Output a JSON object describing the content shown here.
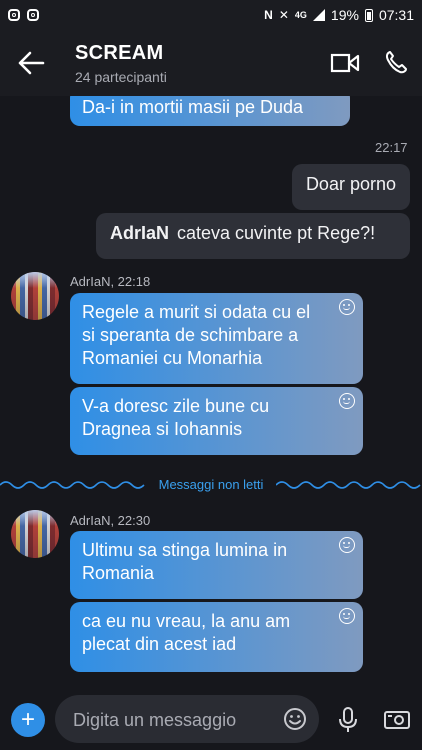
{
  "status_bar": {
    "left_icons": [
      "instagram-icon",
      "instagram-icon"
    ],
    "network": "4G",
    "battery": "19%",
    "time": "07:31"
  },
  "header": {
    "title": "SCREAM",
    "subtitle": "24 partecipanti"
  },
  "messages": {
    "partial_top": "Da-i in mortii masii pe Duda",
    "time_2217": "22:17",
    "out1": "Doar porno",
    "out2_sender": "AdrIaN",
    "out2_text": "cateva cuvinte pt Rege?!",
    "group1_meta": "AdrIaN, 22:18",
    "g1_msg1": "Regele a murit si odata cu el si speranta de schimbare a Romaniei cu Monarhia",
    "g1_msg2": "V-a doresc zile bune cu Dragnea si Iohannis",
    "unread_label": "Messaggi non letti",
    "group2_meta": "AdrIaN, 22:30",
    "g2_msg1": "Ultimu sa stinga lumina in Romania",
    "g2_msg2": "ca eu nu vreau, la anu am plecat din acest iad"
  },
  "composer": {
    "placeholder": "Digita un messaggio"
  },
  "colors": {
    "accent": "#2f8fe6",
    "background": "#16171c",
    "outgoing_bubble": "#2e3038"
  }
}
